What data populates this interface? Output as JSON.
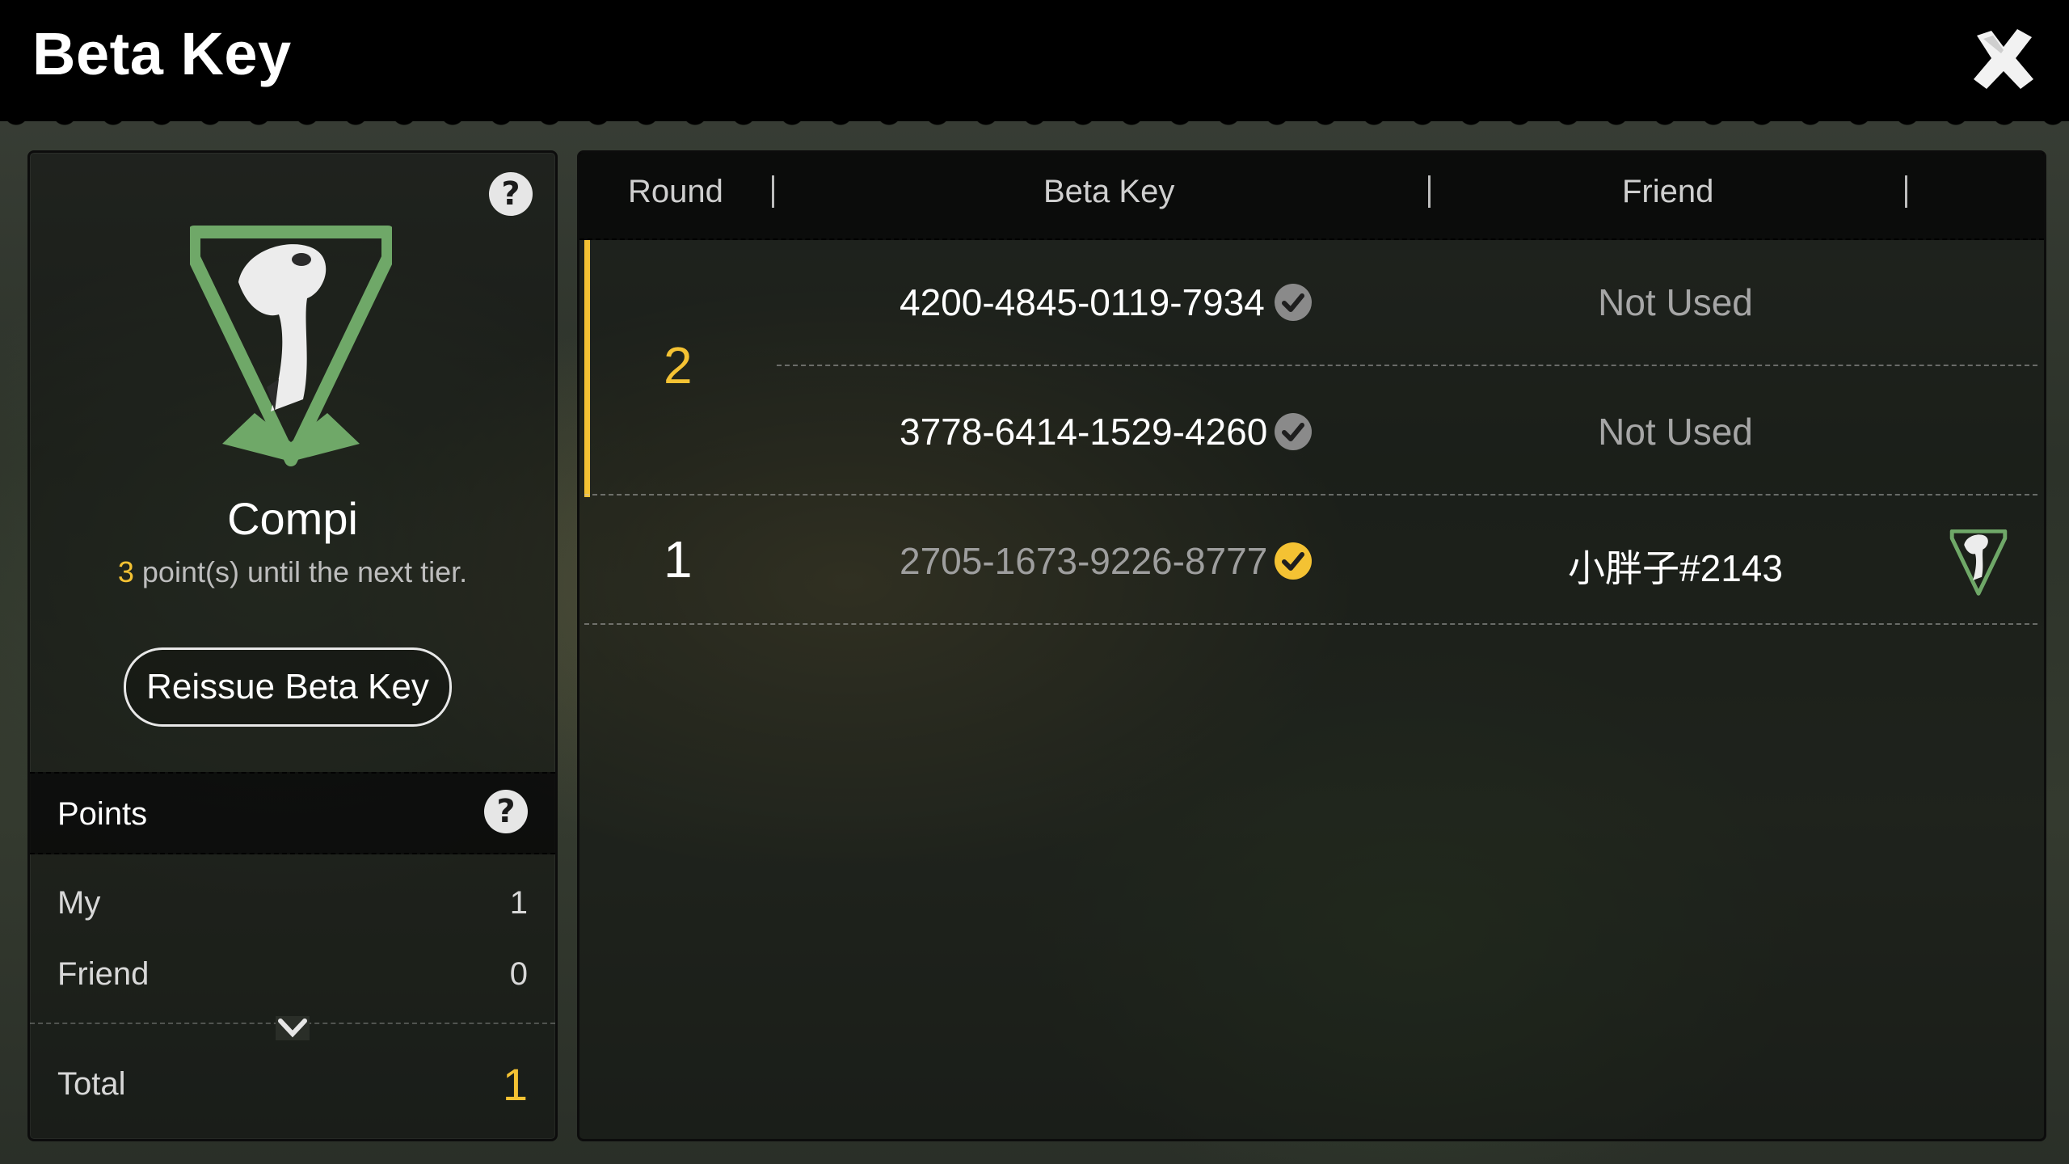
{
  "header": {
    "title": "Beta Key",
    "close_icon": "close-icon"
  },
  "tier": {
    "emblem_icon": "raptor-shield-icon",
    "name": "Compi",
    "points_needed": "3",
    "progress_suffix": " point(s) until the next tier.",
    "reissue_label": "Reissue Beta Key"
  },
  "points": {
    "title": "Points",
    "my_label": "My",
    "my_value": "1",
    "friend_label": "Friend",
    "friend_value": "0",
    "total_label": "Total",
    "total_value": "1"
  },
  "table": {
    "columns": [
      "Round",
      "Beta Key",
      "Friend"
    ],
    "rounds": [
      {
        "round": "2",
        "keys": [
          {
            "key": "4200-4845-0119-7934",
            "friend": "Not Used",
            "used": false
          },
          {
            "key": "3778-6414-1529-4260",
            "friend": "Not Used",
            "used": false
          }
        ]
      },
      {
        "round": "1",
        "keys": [
          {
            "key": "2705-1673-9226-8777",
            "friend": "小胖子#2143",
            "used": true
          }
        ]
      }
    ]
  },
  "colors": {
    "accent_yellow": "#f4c233",
    "emblem_green": "#6fa868",
    "check_gray": "#8a8a8a"
  }
}
